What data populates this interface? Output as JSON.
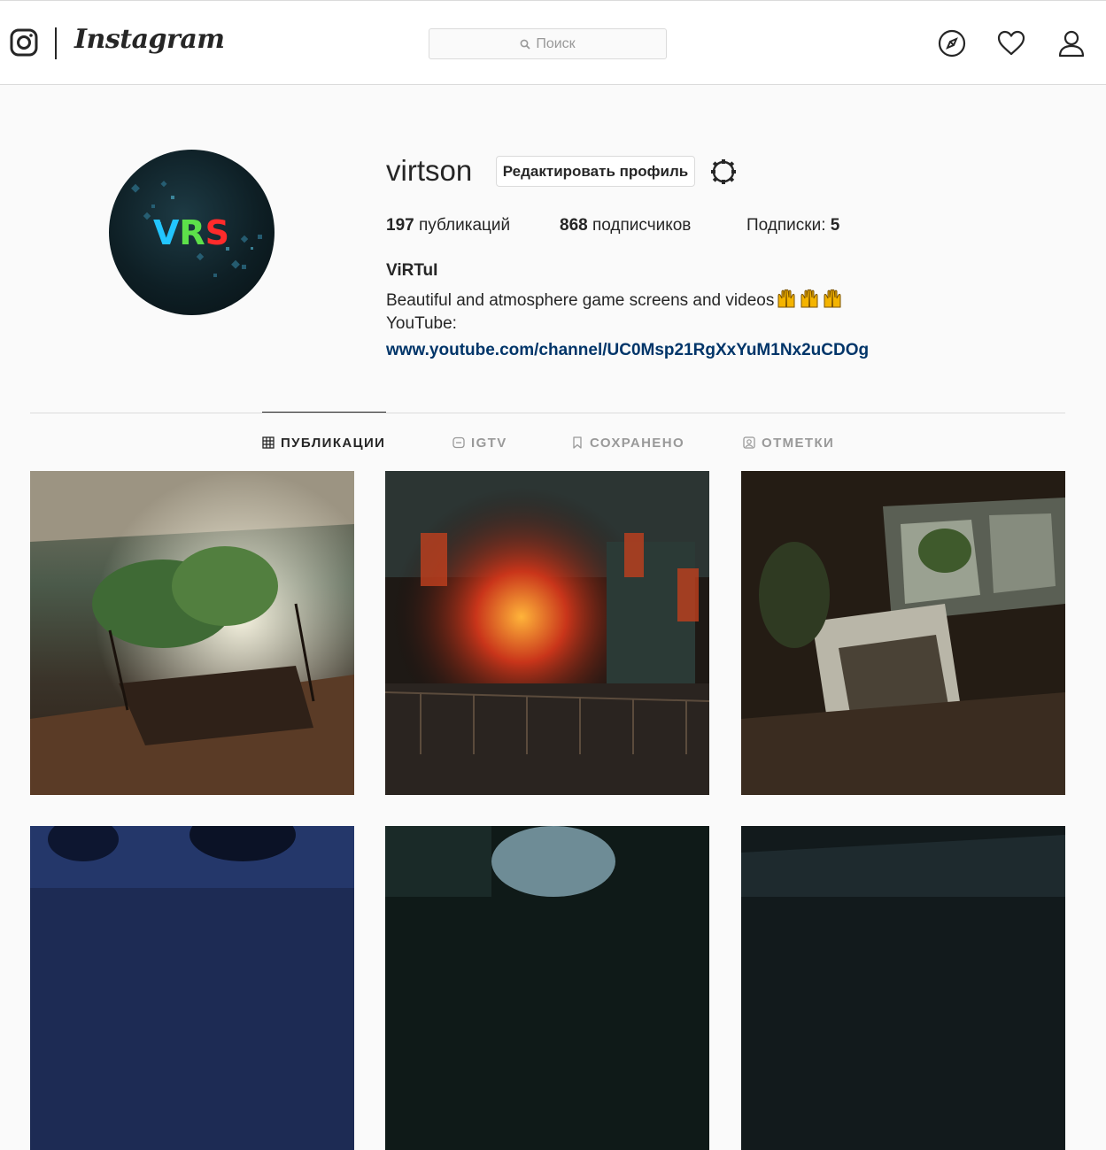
{
  "header": {
    "logo_text": "Instagram",
    "search_placeholder": "Поиск",
    "icons": [
      "instagram-glyph-icon",
      "compass-icon",
      "heart-icon",
      "user-icon",
      "search-icon"
    ]
  },
  "profile": {
    "username": "virtson",
    "edit_button": "Редактировать профиль",
    "avatar_text": "VRS",
    "stats": {
      "posts_count": "197",
      "posts_label": " публикаций",
      "followers_count": "868",
      "followers_label": " подписчиков",
      "following_label": "Подписки: ",
      "following_count": "5"
    },
    "bio": {
      "name": "ViRTuI",
      "line1": "Beautiful and atmosphere game screens and videos",
      "line2": "YouTube:",
      "link": "www.youtube.com/channel/UC0Msp21RgXxYuM1Nx2uCDOg"
    }
  },
  "tabs": [
    {
      "label": "ПУБЛИКАЦИИ",
      "icon": "grid-icon",
      "active": true
    },
    {
      "label": "IGTV",
      "icon": "tv-icon",
      "active": false
    },
    {
      "label": "СОХРАНЕНО",
      "icon": "bookmark-icon",
      "active": false
    },
    {
      "label": "ОТМЕТКИ",
      "icon": "tag-person-icon",
      "active": false
    }
  ],
  "colors": {
    "text": "#262626",
    "muted": "#999999",
    "border": "#dbdbdb",
    "link": "#003569",
    "background": "#fafafa"
  }
}
